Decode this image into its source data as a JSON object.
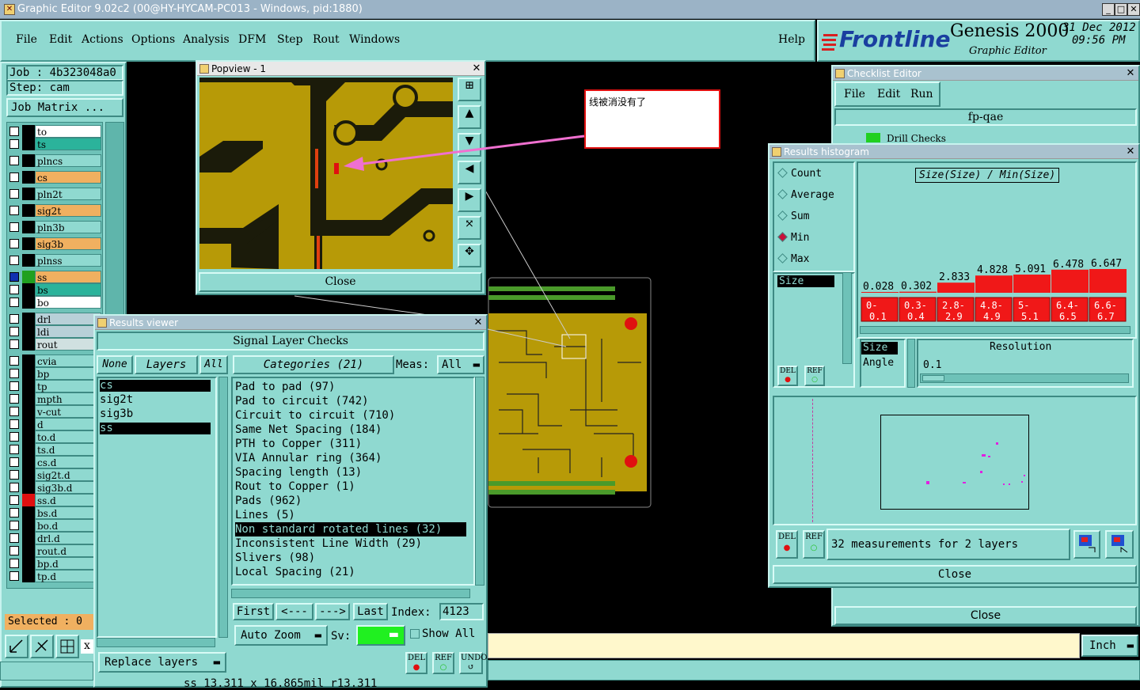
{
  "window": {
    "title": "Graphic Editor 9.02c2 (00@HY-HYCAM-PC013 - Windows, pid:1880)",
    "min": "_",
    "max": "□",
    "close": "✕"
  },
  "menu": {
    "items": [
      "File",
      "Edit",
      "Actions",
      "Options",
      "Analysis",
      "DFM",
      "Step",
      "Rout",
      "Windows"
    ],
    "help": "Help"
  },
  "brand": {
    "logo": "Frontline",
    "product": "Genesis 2000",
    "subtitle": "Graphic Editor",
    "date": "31 Dec 2012",
    "time": "09:56 PM"
  },
  "job": {
    "job_label": "Job : 4b323048a0",
    "step_label": "Step: cam",
    "matrix_button": "Job Matrix ..."
  },
  "layers": [
    {
      "name": "to",
      "color": "#ffffff"
    },
    {
      "name": "ts",
      "color": "#2bb39b"
    },
    {
      "name": "plncs",
      "color": "#8fd9d0"
    },
    {
      "name": "cs",
      "color": "#f0b060"
    },
    {
      "name": "pln2t",
      "color": "#8fd9d0"
    },
    {
      "name": "sig2t",
      "color": "#f0b060"
    },
    {
      "name": "pln3b",
      "color": "#8fd9d0"
    },
    {
      "name": "sig3b",
      "color": "#f0b060"
    },
    {
      "name": "plnss",
      "color": "#8fd9d0"
    },
    {
      "name": "ss",
      "color": "#f0b060"
    },
    {
      "name": "bs",
      "color": "#2bb39b"
    },
    {
      "name": "bo",
      "color": "#ffffff"
    },
    {
      "name": "drl",
      "color": "#b8d0d8"
    },
    {
      "name": "ldi",
      "color": "#b8d0d8"
    },
    {
      "name": "rout",
      "color": "#d0e0e0"
    },
    {
      "name": "cvia",
      "color": "#8fd9d0"
    },
    {
      "name": "bp",
      "color": "#8fd9d0"
    },
    {
      "name": "tp",
      "color": "#8fd9d0"
    },
    {
      "name": "mpth",
      "color": "#8fd9d0"
    },
    {
      "name": "v-cut",
      "color": "#8fd9d0"
    },
    {
      "name": "d",
      "color": "#8fd9d0"
    },
    {
      "name": "to.d",
      "color": "#8fd9d0"
    },
    {
      "name": "ts.d",
      "color": "#8fd9d0"
    },
    {
      "name": "cs.d",
      "color": "#8fd9d0"
    },
    {
      "name": "sig2t.d",
      "color": "#8fd9d0"
    },
    {
      "name": "sig3b.d",
      "color": "#8fd9d0"
    },
    {
      "name": "ss.d",
      "color": "#8fd9d0"
    },
    {
      "name": "bs.d",
      "color": "#8fd9d0"
    },
    {
      "name": "bo.d",
      "color": "#8fd9d0"
    },
    {
      "name": "drl.d",
      "color": "#8fd9d0"
    },
    {
      "name": "rout.d",
      "color": "#8fd9d0"
    },
    {
      "name": "bp.d",
      "color": "#8fd9d0"
    },
    {
      "name": "tp.d",
      "color": "#8fd9d0"
    }
  ],
  "selected_label": "Selected : 0",
  "popview": {
    "title": "Popview - 1",
    "close": "Close"
  },
  "annotation": {
    "text": "线被消没有了"
  },
  "results_viewer": {
    "title": "Results viewer",
    "header": "Signal Layer Checks",
    "none_btn": "None",
    "layers_btn": "Layers",
    "all_btn": "All",
    "categories_btn": "Categories (21)",
    "meas_label": "Meas:",
    "meas_value": "All",
    "layer_list": [
      "cs",
      "sig2t",
      "sig3b",
      "ss"
    ],
    "categories": [
      "Pad to pad (97)",
      "Pad to circuit (742)",
      "Circuit to circuit (710)",
      "Same Net Spacing (184)",
      "PTH to Copper (311)",
      "VIA Annular ring (364)",
      "Spacing length (13)",
      "Rout to Copper (1)",
      "Pads (962)",
      "Lines (5)",
      "Non standard rotated lines (32)",
      "Inconsistent Line Width (29)",
      "Slivers (98)",
      "Local Spacing (21)"
    ],
    "nav": {
      "first": "First",
      "prev": "<---",
      "next": "--->",
      "last": "Last",
      "index_label": "Index:",
      "index_value": "4123"
    },
    "auto_zoom": "Auto Zoom",
    "sv_label": "Sv:",
    "show_all": "Show All",
    "replace_layers": "Replace layers",
    "del": "DEL",
    "ref": "REF",
    "undo": "UNDO",
    "status": "ss 13.311 x 16.865mil r13.311"
  },
  "checklist": {
    "title": "Checklist Editor",
    "menu": [
      "File",
      "Edit",
      "Run"
    ],
    "name": "fp-qae",
    "row": "Drill Checks",
    "close": "Close"
  },
  "histogram": {
    "title": "Results histogram",
    "modes": [
      "Count",
      "Average",
      "Sum",
      "Min",
      "Max"
    ],
    "selected_mode": "Min",
    "list_item": "Size",
    "graph_title": "Size(Size) / Min(Size)",
    "bars": [
      {
        "label": "0.028",
        "value": 0.028,
        "range": "0- 0.1"
      },
      {
        "label": "0.302",
        "value": 0.302,
        "range": "0.3- 0.4"
      },
      {
        "label": "2.833",
        "value": 2.833,
        "range": "2.8- 2.9"
      },
      {
        "label": "4.828",
        "value": 4.828,
        "range": "4.8- 4.9"
      },
      {
        "label": "5.091",
        "value": 5.091,
        "range": "5- 5.1"
      },
      {
        "label": "6.478",
        "value": 6.478,
        "range": "6.4- 6.5"
      },
      {
        "label": "6.647",
        "value": 6.647,
        "range": "6.6- 6.7"
      }
    ],
    "axis_options": [
      "Size",
      "Angle"
    ],
    "resolution_label": "Resolution",
    "resolution_value": "0.1",
    "summary": "32 measurements for 2 layers",
    "close": "Close",
    "del": "DEL",
    "ref": "REF"
  },
  "status_bar": {
    "unit": "Inch"
  }
}
